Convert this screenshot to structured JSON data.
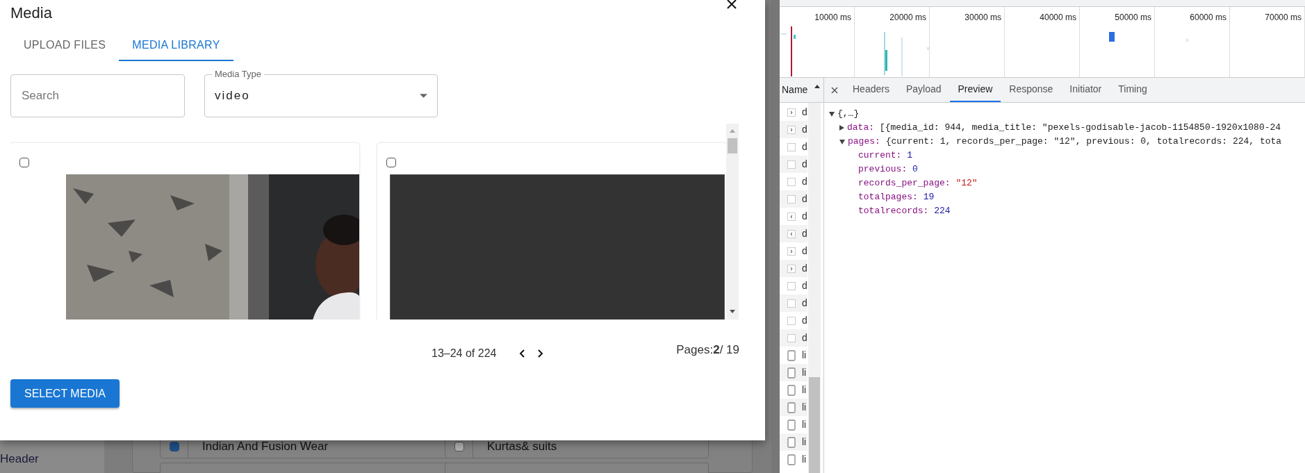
{
  "background_page": {
    "sidebar_label": "Header",
    "rows": [
      {
        "label": "Indian And Fusion Wear",
        "checked": true
      },
      {
        "label": "Kurtas& suits",
        "checked": false
      }
    ]
  },
  "dialog": {
    "title": "Media",
    "tabs": [
      {
        "label": "UPLOAD FILES",
        "selected": false
      },
      {
        "label": "MEDIA LIBRARY",
        "selected": true
      }
    ],
    "search": {
      "placeholder": "Search"
    },
    "media_type": {
      "label": "Media Type",
      "value": "video"
    },
    "cards": [
      {
        "checked": false,
        "kind": "picture"
      },
      {
        "checked": false,
        "kind": "blank"
      }
    ],
    "pagination": {
      "range": "13–24 of 224",
      "pages": "Pages:**2**/ 19"
    },
    "select_button": "SELECT MEDIA"
  },
  "devtools": {
    "timeline_ticks": [
      "10000 ms",
      "20000 ms",
      "30000 ms",
      "40000 ms",
      "50000 ms",
      "60000 ms",
      "70000 ms"
    ],
    "name_header": "Name",
    "requests": [
      {
        "name": "d",
        "kind": "right"
      },
      {
        "name": "d",
        "kind": "right"
      },
      {
        "name": "d",
        "kind": "blank"
      },
      {
        "name": "d",
        "kind": "blank"
      },
      {
        "name": "d",
        "kind": "blank"
      },
      {
        "name": "d",
        "kind": "blank"
      },
      {
        "name": "d",
        "kind": "left"
      },
      {
        "name": "d",
        "kind": "left"
      },
      {
        "name": "d",
        "kind": "right"
      },
      {
        "name": "d",
        "kind": "right"
      },
      {
        "name": "d",
        "kind": "blank"
      },
      {
        "name": "d",
        "kind": "blank"
      },
      {
        "name": "d",
        "kind": "blank"
      },
      {
        "name": "d",
        "kind": "blank"
      },
      {
        "name": "li",
        "kind": "document"
      },
      {
        "name": "li",
        "kind": "document"
      },
      {
        "name": "li",
        "kind": "document"
      },
      {
        "name": "li",
        "kind": "document"
      },
      {
        "name": "li",
        "kind": "document"
      },
      {
        "name": "li",
        "kind": "document"
      },
      {
        "name": "li",
        "kind": "document"
      }
    ],
    "tabs": [
      {
        "label": "Headers",
        "selected": false
      },
      {
        "label": "Payload",
        "selected": false
      },
      {
        "label": "Preview",
        "selected": true
      },
      {
        "label": "Response",
        "selected": false
      },
      {
        "label": "Initiator",
        "selected": false
      },
      {
        "label": "Timing",
        "selected": false
      }
    ],
    "preview": {
      "label": "{,…}",
      "expanded": true,
      "children": [
        {
          "key": "data:",
          "summary": "[{media_id: 944, media_title: \"pexels-godisable-jacob-1154850-1920x1080-24",
          "expanded": false
        },
        {
          "key": "pages:",
          "summary": "{current: 1, records_per_page: \"12\", previous: 0, totalrecords: 224, tota",
          "expanded": true,
          "children": [
            {
              "key": "current:",
              "value": "1",
              "kind": "number"
            },
            {
              "key": "previous:",
              "value": "0",
              "kind": "number"
            },
            {
              "key": "records_per_page:",
              "value": "\"12\"",
              "kind": "string"
            },
            {
              "key": "totalpages:",
              "value": "19",
              "kind": "number"
            },
            {
              "key": "totalrecords:",
              "value": "224",
              "kind": "number"
            }
          ]
        }
      ]
    }
  }
}
